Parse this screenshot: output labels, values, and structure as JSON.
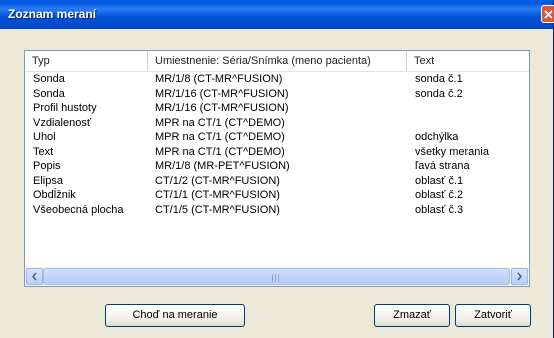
{
  "window": {
    "title": "Zoznam meraní"
  },
  "table": {
    "columns": [
      "Typ",
      "Umiestnenie: Séria/Snímka (meno pacienta)",
      "Text"
    ],
    "rows": [
      [
        "Sonda",
        "MR/1/8  (CT-MR^FUSION)",
        "sonda č.1"
      ],
      [
        "Sonda",
        "MR/1/16  (CT-MR^FUSION)",
        "sonda č.2"
      ],
      [
        "Profil hustoty",
        "MR/1/16  (CT-MR^FUSION)",
        ""
      ],
      [
        "Vzdialenosť",
        "MPR na CT/1  (CT^DEMO)",
        ""
      ],
      [
        "Uhol",
        "MPR na CT/1  (CT^DEMO)",
        "odchýlka"
      ],
      [
        "Text",
        "MPR na CT/1  (CT^DEMO)",
        "všetky merania"
      ],
      [
        "Popis",
        "MR/1/8  (MR-PET^FUSION)",
        "ľavá strana"
      ],
      [
        "Elipsa",
        "CT/1/2  (CT-MR^FUSION)",
        "oblasť č.1"
      ],
      [
        "Obdĺžnik",
        "CT/1/1  (CT-MR^FUSION)",
        "oblasť č.2"
      ],
      [
        "Všeobecná plocha",
        "CT/1/5  (CT-MR^FUSION)",
        "oblasť č.3"
      ]
    ]
  },
  "buttons": {
    "goto": "Choď na meranie",
    "delete": "Zmazať",
    "close": "Zatvoriť"
  },
  "icons": {
    "close": "close-x-icon",
    "scroll_left": "arrow-left-icon",
    "scroll_right": "arrow-right-icon"
  }
}
